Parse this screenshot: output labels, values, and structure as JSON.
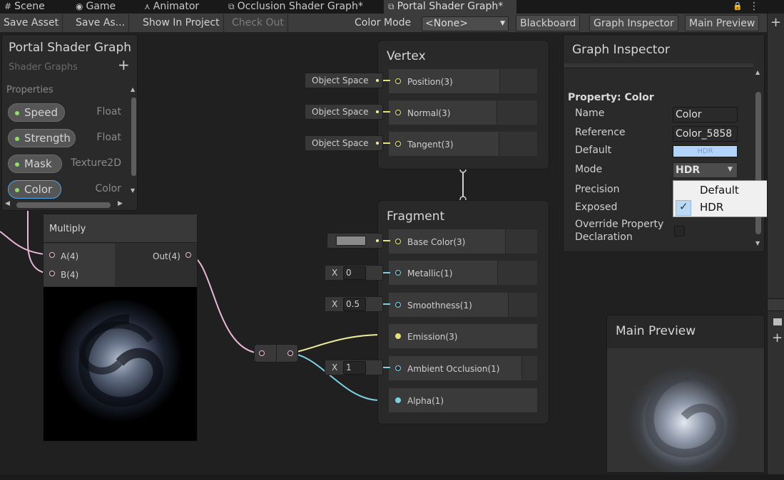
{
  "tabs": [
    {
      "icon": "#",
      "label": "Scene"
    },
    {
      "icon": "◉",
      "label": "Game"
    },
    {
      "icon": "⋏",
      "label": "Animator"
    },
    {
      "icon": "⧉",
      "label": "Occlusion Shader Graph*"
    },
    {
      "icon": "⧉",
      "label": "Portal Shader Graph*"
    }
  ],
  "tab_icons": {
    "lock": "🔒",
    "menu": "⋮",
    "add": "+"
  },
  "toolbar": {
    "save_asset": "Save Asset",
    "save_as": "Save As...",
    "show_in_project": "Show In Project",
    "check_out": "Check Out",
    "color_mode_label": "Color Mode",
    "color_mode_value": "<None>",
    "blackboard": "Blackboard",
    "graph_inspector": "Graph Inspector",
    "main_preview": "Main Preview"
  },
  "blackboard": {
    "title": "Portal Shader Graph",
    "subtitle": "Shader Graphs",
    "add": "+",
    "section": "Properties",
    "properties": [
      {
        "name": "Speed",
        "type": "Float"
      },
      {
        "name": "Strength",
        "type": "Float"
      },
      {
        "name": "Mask",
        "type": "Texture2D"
      },
      {
        "name": "Color",
        "type": "Color"
      }
    ]
  },
  "multiply": {
    "title": "Multiply",
    "in_a": "A(4)",
    "in_b": "B(4)",
    "out": "Out(4)"
  },
  "vertex": {
    "title": "Vertex",
    "slots": [
      {
        "label": "Position(3)",
        "ext": "Object Space"
      },
      {
        "label": "Normal(3)",
        "ext": "Object Space"
      },
      {
        "label": "Tangent(3)",
        "ext": "Object Space"
      }
    ]
  },
  "fragment": {
    "title": "Fragment",
    "slots": [
      {
        "label": "Base Color(3)"
      },
      {
        "label": "Metallic(1)",
        "x": "X",
        "value": "0"
      },
      {
        "label": "Smoothness(1)",
        "x": "X",
        "value": "0.5"
      },
      {
        "label": "Emission(3)"
      },
      {
        "label": "Ambient Occlusion(1)",
        "x": "X",
        "value": "1"
      },
      {
        "label": "Alpha(1)"
      }
    ]
  },
  "inspector": {
    "title": "Graph Inspector",
    "section": "Property: Color",
    "name_label": "Name",
    "name_value": "Color",
    "reference_label": "Reference",
    "reference_value": "Color_5858",
    "default_label": "Default",
    "default_swatch_text": "HDR",
    "mode_label": "Mode",
    "mode_value": "HDR",
    "precision_label": "Precision",
    "exposed_label": "Exposed",
    "override_label_1": "Override Property",
    "override_label_2": "Declaration"
  },
  "mode_dropdown": {
    "options": [
      "Default",
      "HDR"
    ],
    "selected": "HDR",
    "check": "✓"
  },
  "preview": {
    "title": "Main Preview"
  },
  "colors": {
    "accent_yellow": "#e6e27a",
    "accent_blue": "#7cd0e4",
    "wire_pink": "#e9b7d8",
    "property_dot": "#8fdc6a",
    "hdr_swatch": "#b3d4ff",
    "base_color_swatch": "#8a8a8a"
  }
}
